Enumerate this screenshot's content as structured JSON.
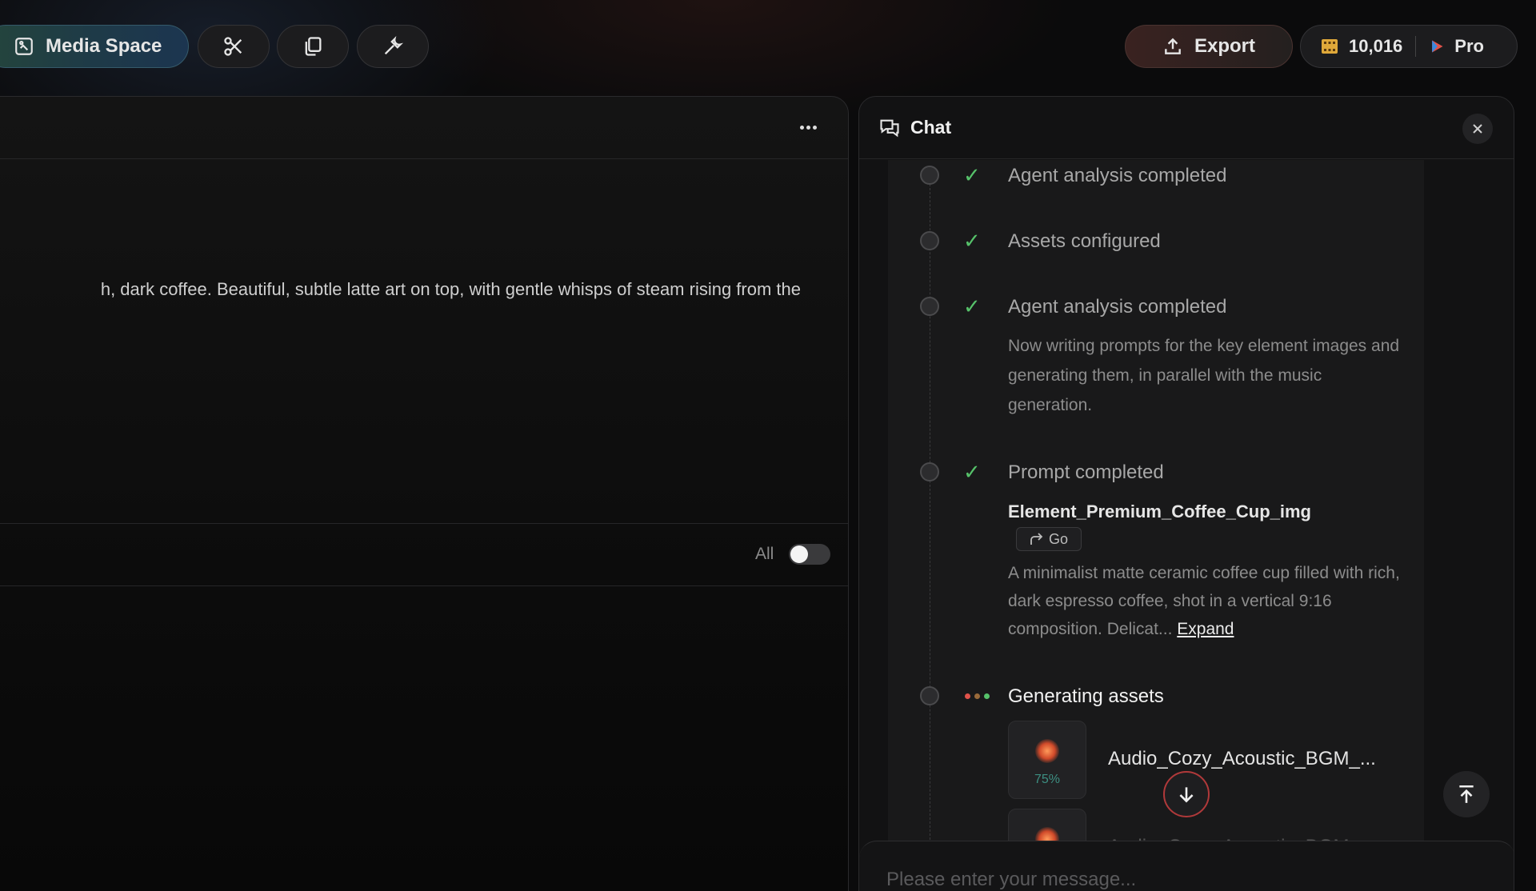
{
  "topbar": {
    "media_space_label": "Media Space",
    "export_label": "Export",
    "credits": "10,016",
    "plan": "Pro",
    "icons": [
      "media-space-icon",
      "scissors-icon",
      "copy-icon",
      "wrench-icon",
      "upload-icon",
      "film-icon",
      "brand-play-icon"
    ]
  },
  "editor": {
    "prompt_text": "h, dark coffee. Beautiful, subtle latte art on top, with gentle whisps of steam rising from the",
    "filter_label": "All",
    "filter_toggle_on": false
  },
  "chat": {
    "title": "Chat",
    "steps": [
      {
        "title": "Agent analysis completed",
        "status": "done"
      },
      {
        "title": "Assets configured",
        "status": "done"
      },
      {
        "title": "Agent analysis completed",
        "status": "done",
        "description": "Now writing prompts for the key element images and generating them, in parallel with the music generation."
      },
      {
        "title": "Prompt completed",
        "status": "done",
        "asset_name": "Element_Premium_Coffee_Cup_img",
        "go_label": "Go",
        "description": "A minimalist matte ceramic coffee cup filled with rich, dark espresso coffee, shot in a vertical 9:16 composition. Delicat...",
        "expand_label": "Expand"
      },
      {
        "title": "Generating assets",
        "status": "in-progress",
        "assets": [
          {
            "name": "Audio_Cozy_Acoustic_BGM_...",
            "progress": "75%"
          },
          {
            "name": "Audio_Cozy_Acoustic_BGM_...",
            "progress": ""
          }
        ]
      }
    ],
    "input_placeholder": "Please enter your message..."
  },
  "colors": {
    "success": "#56c26a",
    "loading_dots": [
      "#e0524a",
      "#9a6a3a",
      "#56c26a"
    ],
    "accent_teal": "#3d8f82"
  }
}
